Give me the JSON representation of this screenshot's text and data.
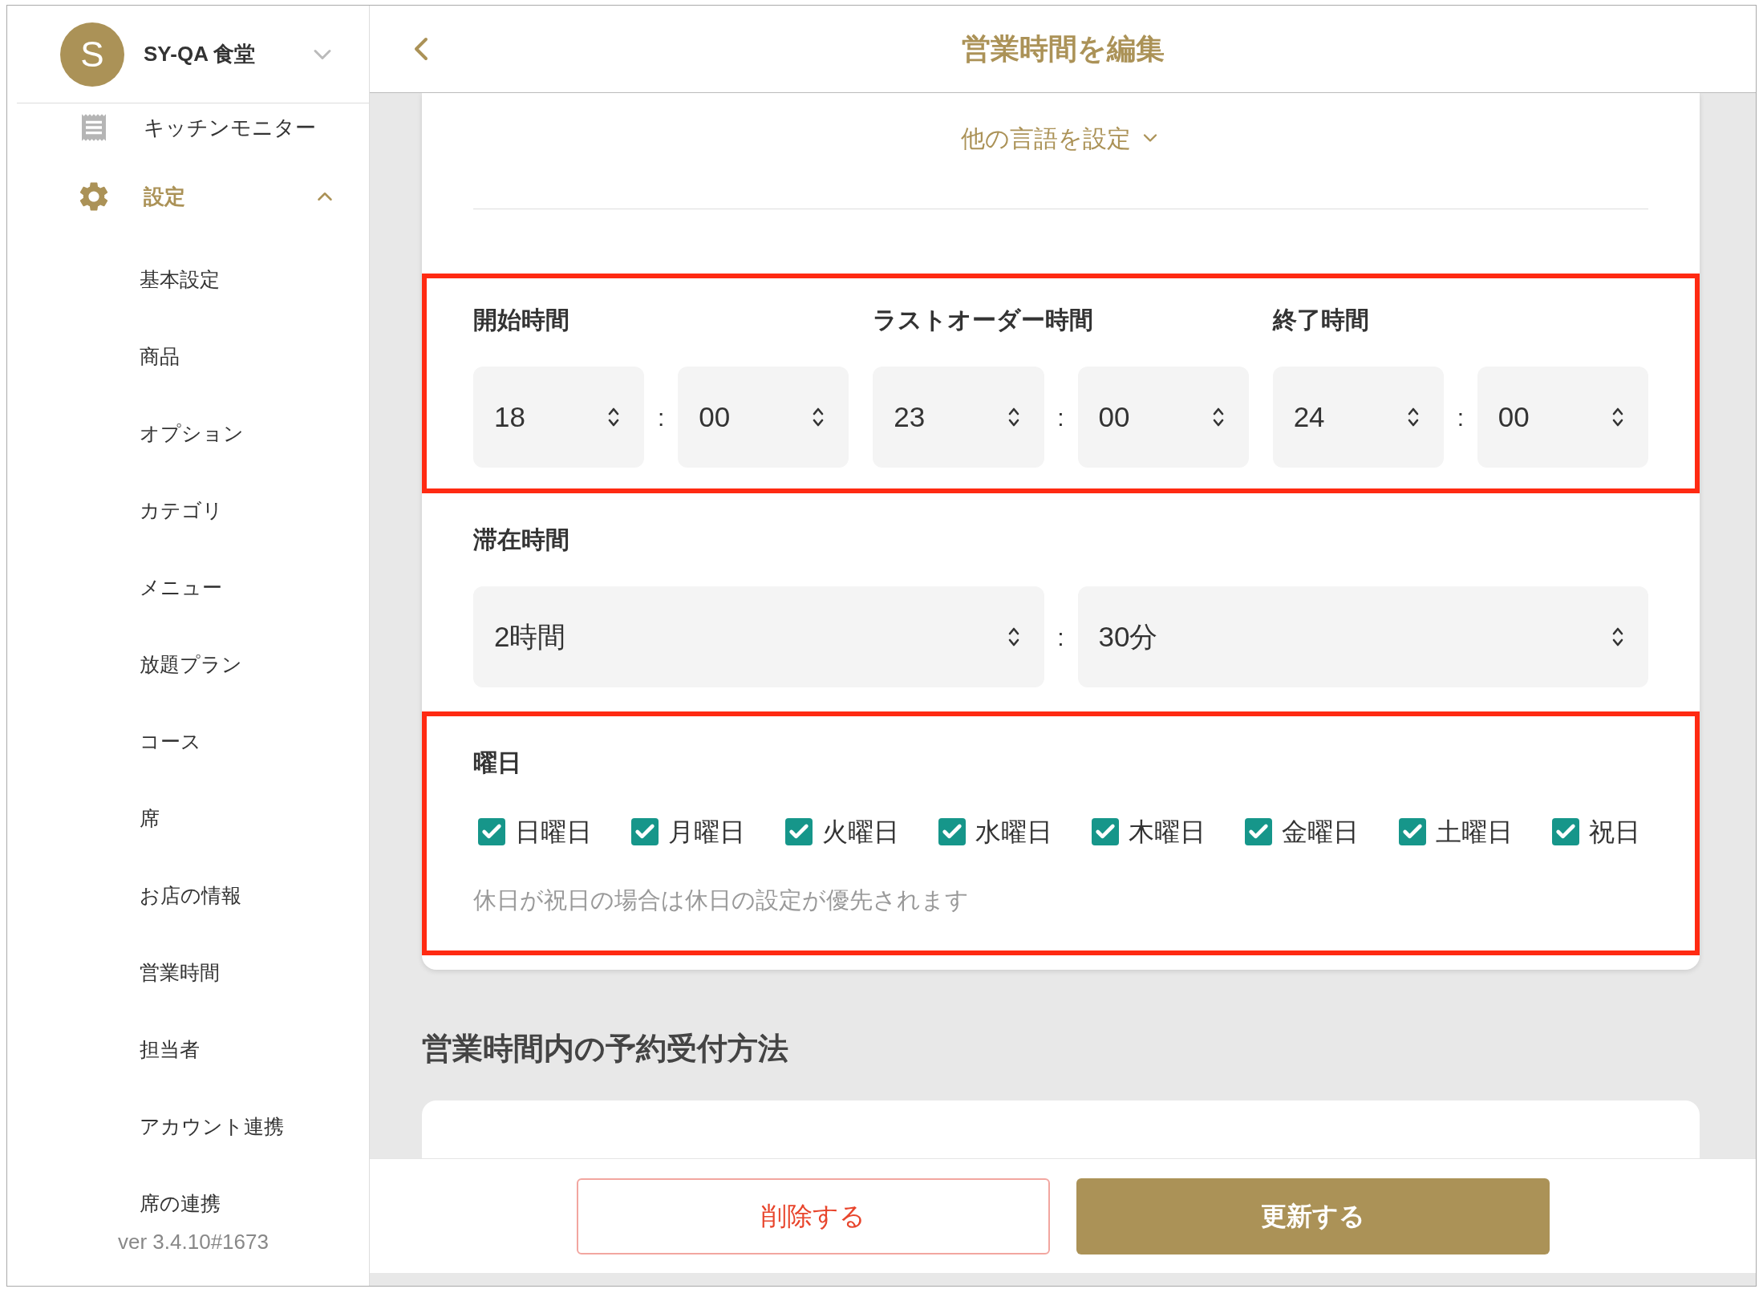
{
  "sidebar": {
    "store": {
      "initial": "S",
      "name": "SY-QA 食堂"
    },
    "nav": [
      {
        "kind": "link",
        "label": "キッチンモニター",
        "active": false
      },
      {
        "kind": "group",
        "label": "設定",
        "active": true,
        "expanded": true,
        "children": [
          {
            "label": "基本設定"
          },
          {
            "label": "商品"
          },
          {
            "label": "オプション"
          },
          {
            "label": "カテゴリ"
          },
          {
            "label": "メニュー"
          },
          {
            "label": "放題プラン"
          },
          {
            "label": "コース"
          },
          {
            "label": "席"
          },
          {
            "label": "お店の情報"
          },
          {
            "label": "営業時間"
          },
          {
            "label": "担当者"
          },
          {
            "label": "アカウント連携"
          },
          {
            "label": "席の連携"
          }
        ]
      }
    ],
    "version": "ver 3.4.10#1673"
  },
  "header": {
    "title": "営業時間を編集"
  },
  "form": {
    "language_link": "他の言語を設定",
    "times": {
      "highlighted": true,
      "groups": [
        {
          "label": "開始時間",
          "hour": "18",
          "minute": "00"
        },
        {
          "label": "ラストオーダー時間",
          "hour": "23",
          "minute": "00"
        },
        {
          "label": "終了時間",
          "hour": "24",
          "minute": "00"
        }
      ]
    },
    "stay": {
      "highlighted": false,
      "label": "滞在時間",
      "hours": "2時間",
      "minutes": "30分"
    },
    "weekdays": {
      "highlighted": true,
      "label": "曜日",
      "days": [
        {
          "label": "日曜日",
          "checked": true
        },
        {
          "label": "月曜日",
          "checked": true
        },
        {
          "label": "火曜日",
          "checked": true
        },
        {
          "label": "水曜日",
          "checked": true
        },
        {
          "label": "木曜日",
          "checked": true
        },
        {
          "label": "金曜日",
          "checked": true
        },
        {
          "label": "土曜日",
          "checked": true
        },
        {
          "label": "祝日",
          "checked": true
        }
      ],
      "note": "休日が祝日の場合は休日の設定が優先されます"
    },
    "colon": ":"
  },
  "reservation_section": {
    "title": "営業時間内の予約受付方法"
  },
  "footer": {
    "delete_button": "削除する",
    "update_button": "更新する"
  }
}
